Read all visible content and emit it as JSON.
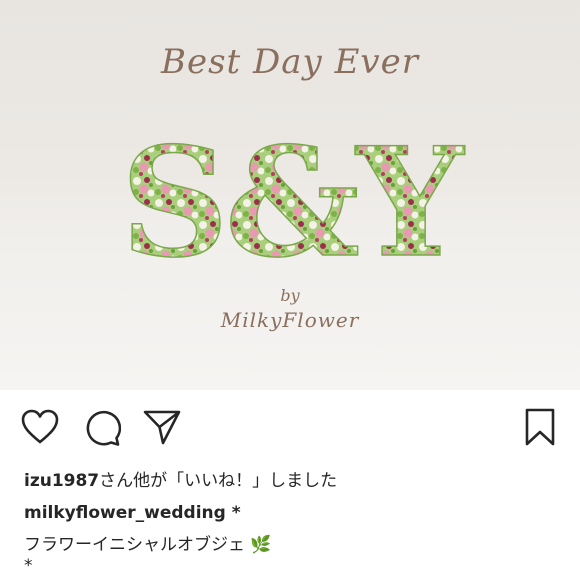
{
  "post": {
    "image": {
      "title_script": "Best Day Ever",
      "monogram": "S&Y",
      "byline_by": "by",
      "byline_brand": "MilkyFlower"
    },
    "actions": {
      "like_icon": "heart-icon",
      "comment_icon": "comment-icon",
      "share_icon": "paper-plane-icon",
      "save_icon": "bookmark-icon"
    },
    "likes": {
      "user": "izu1987",
      "text": "さん他が「いいね！」しました"
    },
    "caption": {
      "username": "milkyflower_wedding *",
      "line1": "フラワーイニシャルオブジェ",
      "line1_emoji": "🌿",
      "line2": "*"
    }
  },
  "colors": {
    "text": "#262626",
    "script": "#8a6f5e",
    "flower_green": "#8fbf5a",
    "flower_pink": "#e79ab1",
    "flower_berry": "#9b2f4c",
    "flower_white": "#f4f1e6"
  }
}
